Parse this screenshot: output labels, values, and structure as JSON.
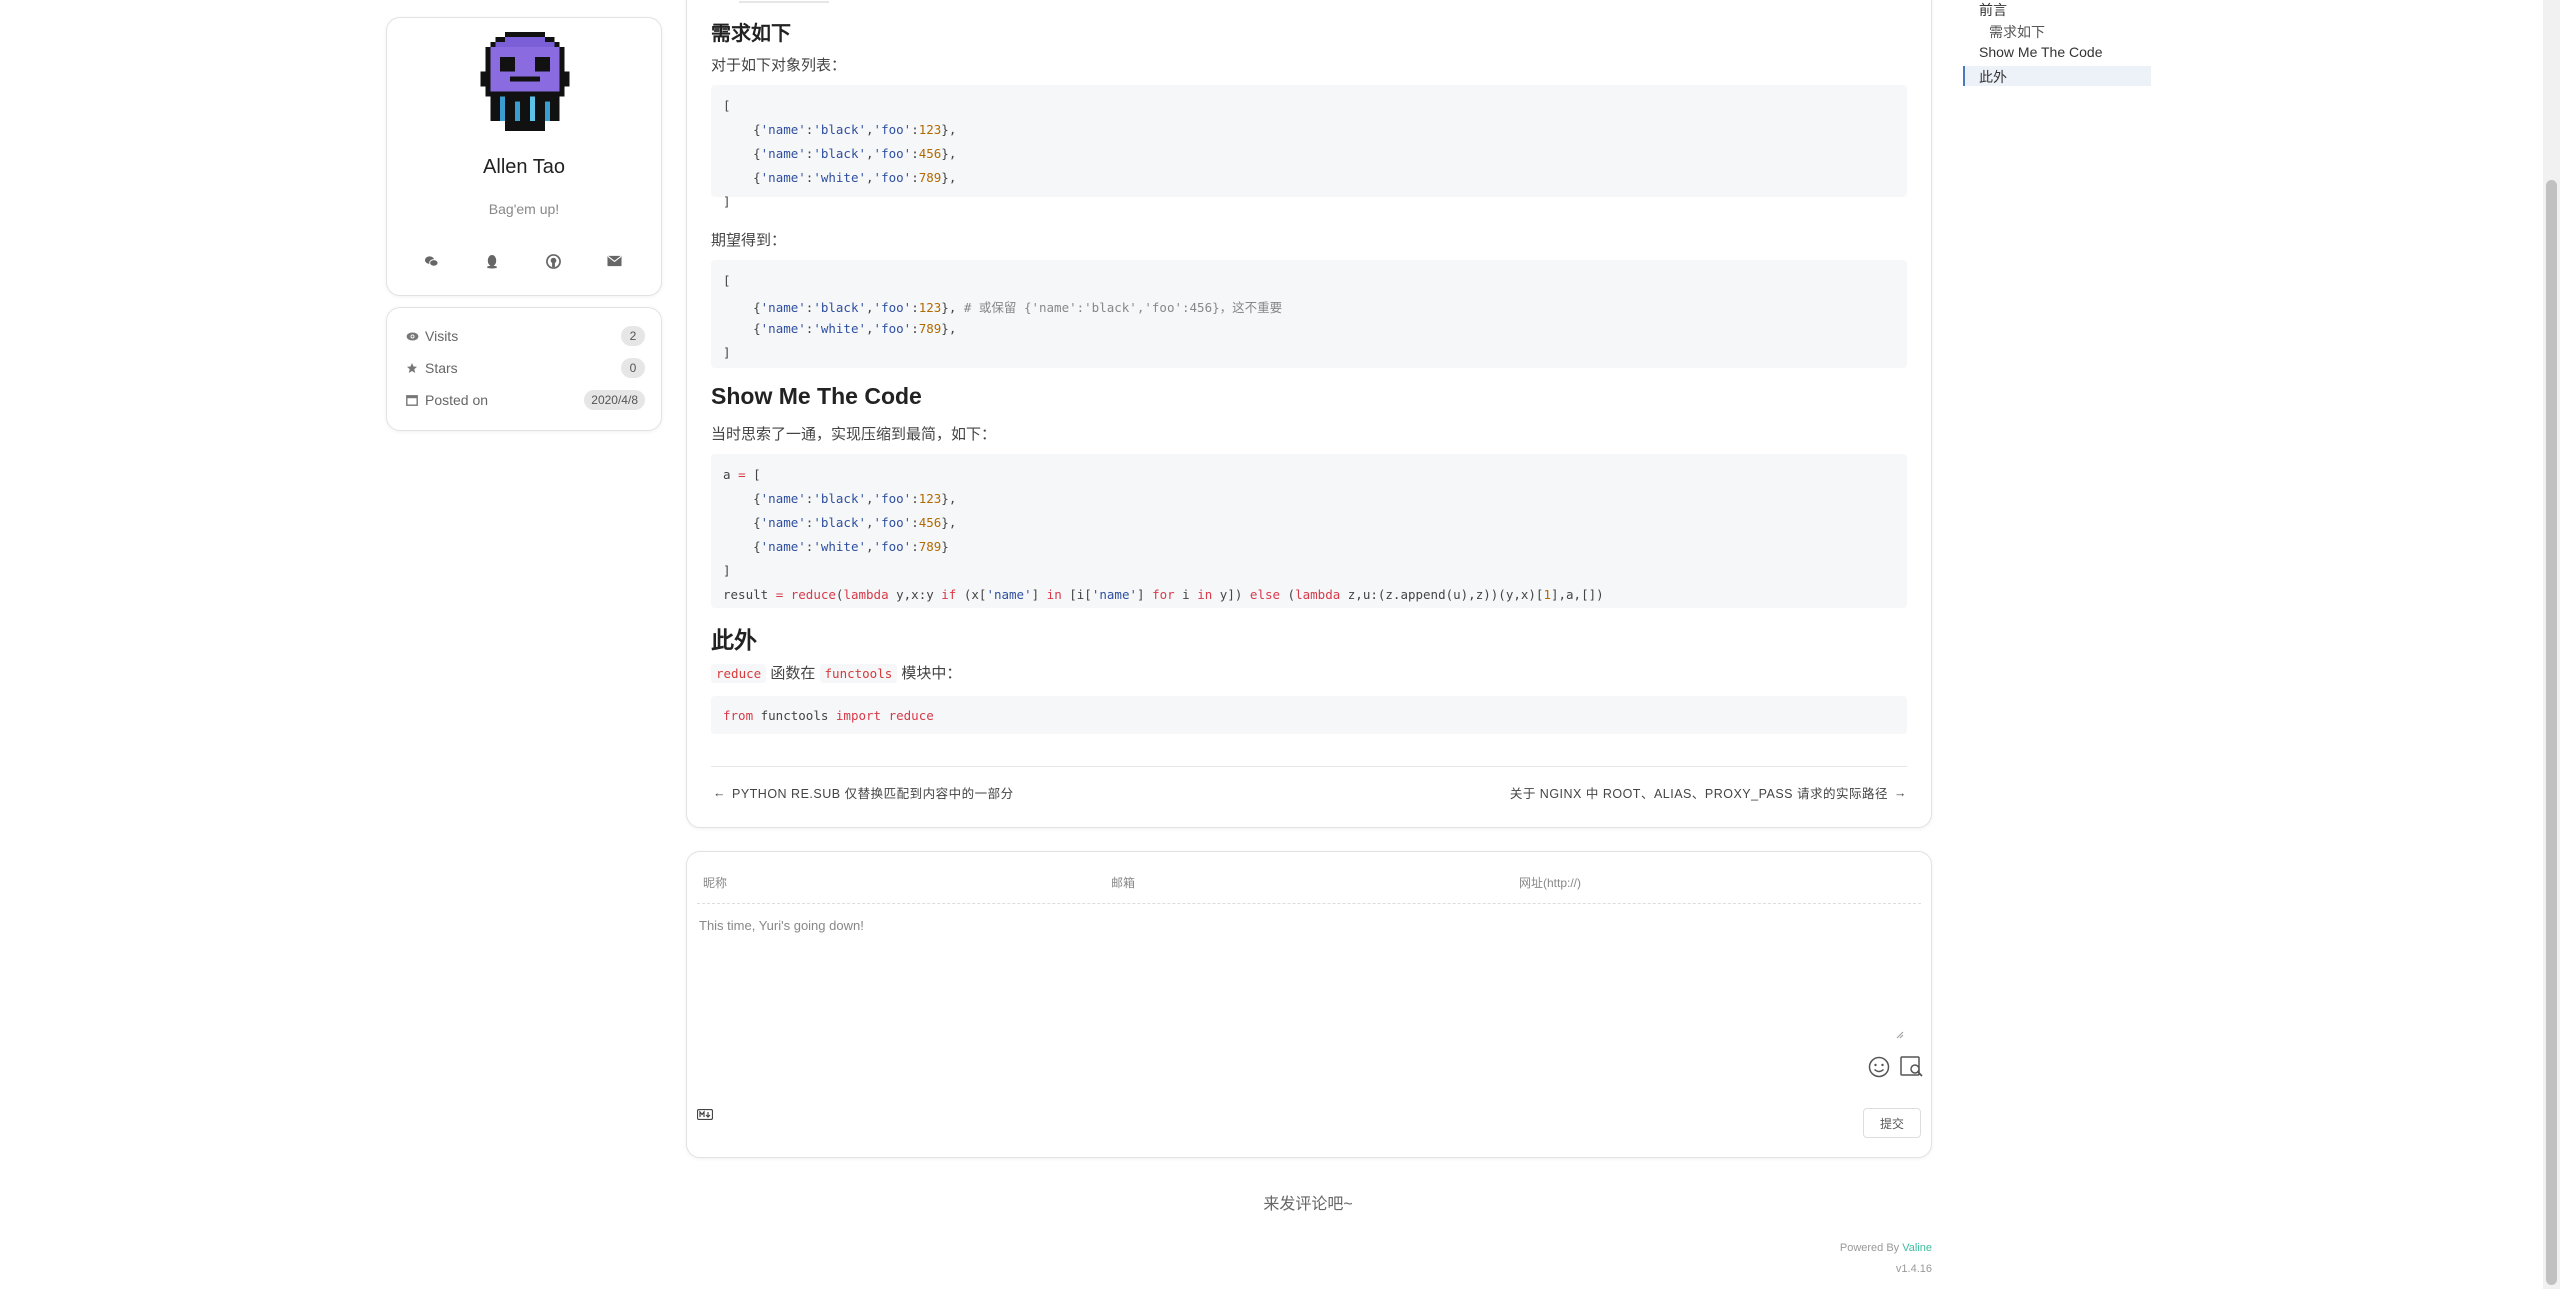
{
  "profile": {
    "name": "Allen Tao",
    "motto": "Bag'em up!",
    "social_icons": [
      "wechat-icon",
      "qq-icon",
      "github-icon",
      "email-icon"
    ]
  },
  "stats": {
    "visits_label": "Visits",
    "visits_value": "2",
    "stars_label": "Stars",
    "stars_value": "0",
    "posted_label": "Posted on",
    "posted_value": "2020/4/8"
  },
  "article": {
    "h_requirement": "需求如下",
    "p_list_intro": "对于如下对象列表：",
    "p_expected": "期望得到：",
    "h_code": "Show Me The Code",
    "p_thought": "当时思索了一通，实现压缩到最简，如下：",
    "h_also": "此外",
    "inline_reduce": "reduce",
    "text_in": "函数在",
    "inline_functools": "functools",
    "text_module": "模块中：",
    "code1": [
      "[",
      "    {'name':'black','foo':123},",
      "    {'name':'black','foo':456},",
      "    {'name':'white','foo':789},",
      "]"
    ],
    "code2": [
      "[",
      "    {'name':'black','foo':123}, # 或保留 {'name':'black','foo':456}，这不重要",
      "    {'name':'white','foo':789},",
      "]"
    ],
    "code3": [
      "a = [",
      "    {'name':'black','foo':123},",
      "    {'name':'black','foo':456},",
      "    {'name':'white','foo':789}",
      "]",
      "result = reduce(lambda y,x:y if (x['name'] in [i['name'] for i in y]) else (lambda z,u:(z.append(u),z))(y,x)[1],a,[])"
    ],
    "code4": "from functools import reduce",
    "prev_post": "PYTHON RE.SUB 仅替换匹配到内容中的一部分",
    "next_post": "关于 NGINX 中 ROOT、ALIAS、PROXY_PASS 请求的实际路径"
  },
  "comments": {
    "nick_placeholder": "昵称",
    "mail_placeholder": "邮箱",
    "link_placeholder": "网址(http://)",
    "text_placeholder": "This time, Yuri's going down!",
    "submit_label": "提交",
    "empty_text": "来发评论吧~",
    "powered_by": "Powered By",
    "valine": "Valine",
    "version": "v1.4.16"
  },
  "toc": {
    "items": [
      "前言",
      "需求如下",
      "Show Me The Code",
      "此外"
    ],
    "active": "此外"
  },
  "colors": {
    "accent": "#4a78c2",
    "valine": "#3dbb9f",
    "keyword": "#d73a49"
  }
}
